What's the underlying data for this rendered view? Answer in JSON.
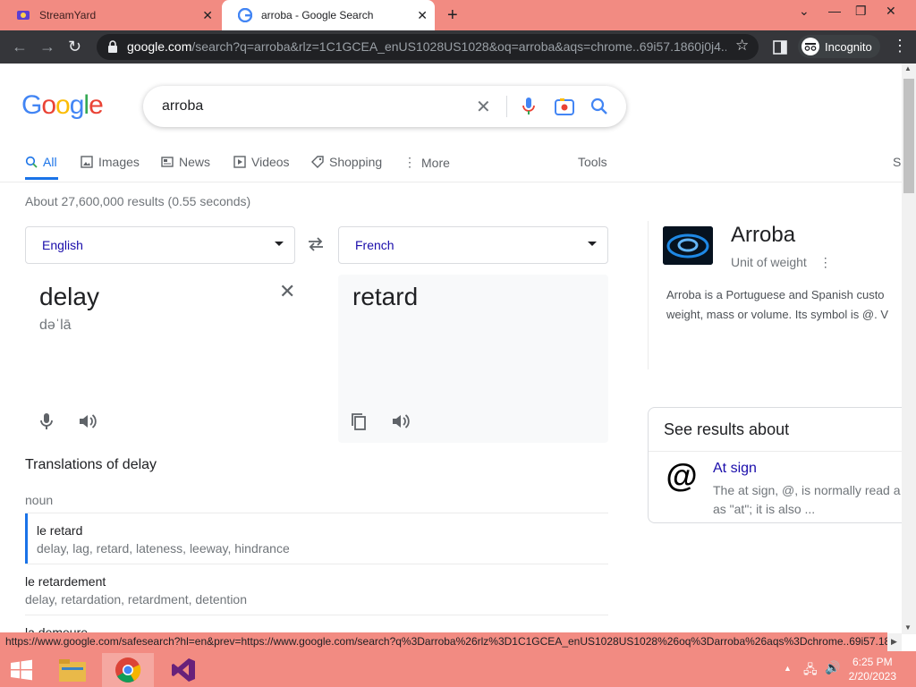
{
  "browser": {
    "tabs": [
      {
        "title": "StreamYard",
        "active": false
      },
      {
        "title": "arroba - Google Search",
        "active": true
      }
    ],
    "url_host": "google.com",
    "url_rest": "/search?q=arroba&rlz=1C1GCEA_enUS1028US1028&oq=arroba&aqs=chrome..69i57.1860j0j4...",
    "profile_label": "Incognito"
  },
  "search": {
    "query": "arroba",
    "nav_tabs": [
      "All",
      "Images",
      "News",
      "Videos",
      "Shopping",
      "More"
    ],
    "tools_label": "Tools",
    "safesearch_partial": "S",
    "stats": "About 27,600,000 results (0.55 seconds)"
  },
  "translate": {
    "source_lang": "English",
    "target_lang": "French",
    "source_word": "delay",
    "transliteration": "dəˈlā",
    "target_word": "retard",
    "translations_heading": "Translations of delay",
    "part_of_speech": "noun",
    "rows": [
      {
        "main": "le retard",
        "syn": "delay, lag, retard, lateness, leeway, hindrance"
      },
      {
        "main": "le retardement",
        "syn": "delay, retardation, retardment, detention"
      },
      {
        "main": "la demeure",
        "syn": ""
      }
    ]
  },
  "knowledge_panel": {
    "title": "Arroba",
    "subtitle": "Unit of weight",
    "desc_line1": "Arroba is a Portuguese and Spanish custo",
    "desc_line2": "weight, mass or volume. Its symbol is @. V",
    "see_results_heading": "See results about",
    "related_title": "At sign",
    "related_desc_line1": "The at sign, @, is normally read a",
    "related_desc_line2": "as \"at\"; it is also ..."
  },
  "status_url": "https://www.google.com/safesearch?hl=en&prev=https://www.google.com/search?q%3Darroba%26rlz%3D1C1GCEA_enUS1028US1028%26oq%3Darroba%26aqs%3Dchrome..69i57.18...",
  "taskbar": {
    "time": "6:25 PM",
    "date": "2/20/2023"
  },
  "colors": {
    "accent_blue": "#1a73e8",
    "link": "#1a0dab",
    "chrome_frame": "#f28b82",
    "toolbar_dark": "#35363a"
  }
}
